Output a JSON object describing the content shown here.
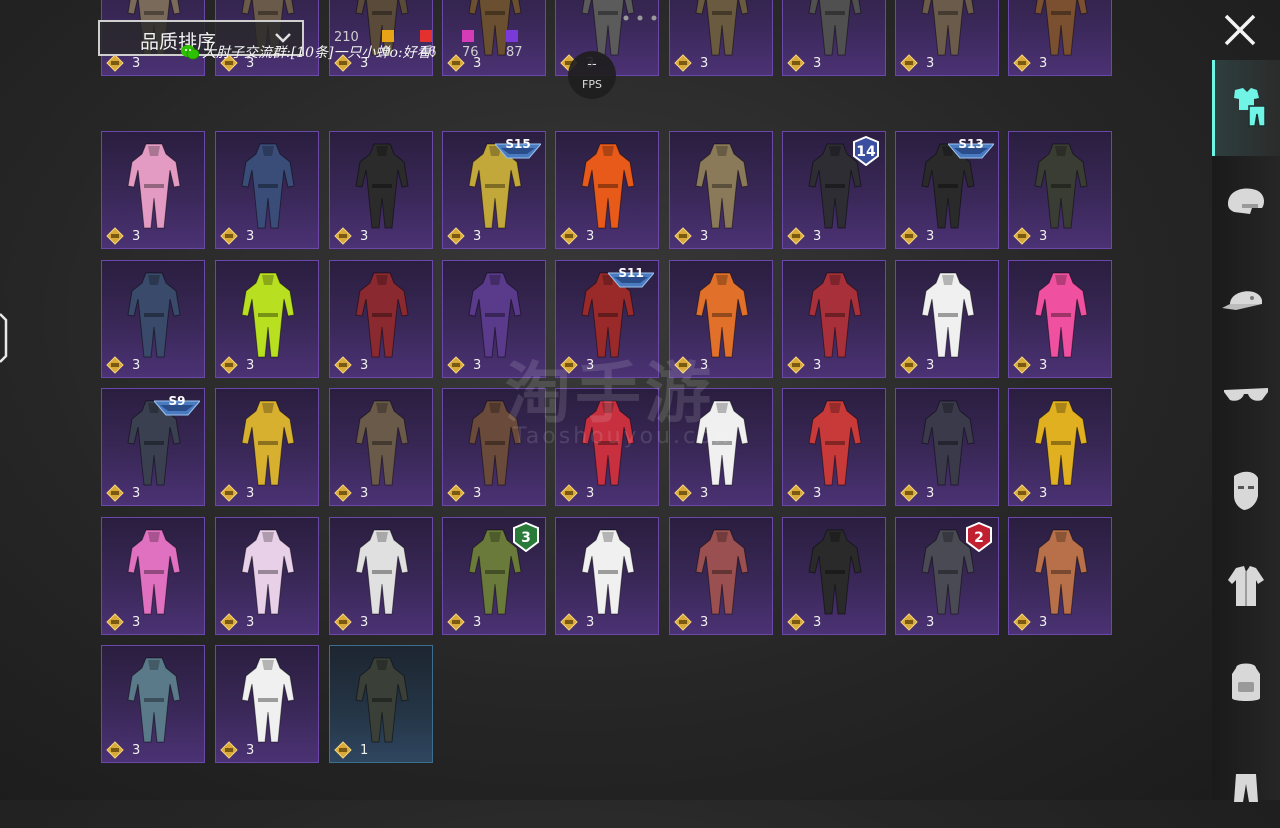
{
  "sort_dropdown": {
    "label": "品质排序"
  },
  "quality_counts": [
    {
      "value": "210",
      "color": ""
    },
    {
      "value": "0",
      "color": "#e8a317"
    },
    {
      "value": "46",
      "color": "#e53030"
    },
    {
      "value": "76",
      "color": "#d63bb8"
    },
    {
      "value": "87",
      "color": "#7a3ad9"
    }
  ],
  "notice": "大肘子交流群:[10条]一只小蝉o:好看!",
  "fps": {
    "value": "--",
    "unit": "FPS"
  },
  "watermark": {
    "line1": "淘手游",
    "line2": "Taoshouyou.com"
  },
  "sidebar_categories": [
    {
      "name": "outfit-icon",
      "active": true
    },
    {
      "name": "helmet-icon",
      "active": false
    },
    {
      "name": "cap-icon",
      "active": false
    },
    {
      "name": "glasses-icon",
      "active": false
    },
    {
      "name": "mask-icon",
      "active": false
    },
    {
      "name": "jacket-icon",
      "active": false
    },
    {
      "name": "backpack-icon",
      "active": false
    },
    {
      "name": "pants-icon",
      "active": false
    }
  ],
  "items": [
    {
      "row": 0,
      "col": 0,
      "count": "3",
      "color": "#7a6a5a"
    },
    {
      "row": 0,
      "col": 1,
      "count": "3",
      "color": "#6a5a4a"
    },
    {
      "row": 0,
      "col": 2,
      "count": "3",
      "color": "#5a4a3a"
    },
    {
      "row": 0,
      "col": 3,
      "count": "3",
      "color": "#6a5030"
    },
    {
      "row": 0,
      "col": 4,
      "count": "3",
      "color": "#5b5b5b"
    },
    {
      "row": 0,
      "col": 5,
      "count": "3",
      "color": "#6a5a40"
    },
    {
      "row": 0,
      "col": 6,
      "count": "3",
      "color": "#505050"
    },
    {
      "row": 0,
      "col": 7,
      "count": "3",
      "color": "#6b5b4b"
    },
    {
      "row": 0,
      "col": 8,
      "count": "3",
      "color": "#7a5030"
    },
    {
      "row": 1,
      "col": 0,
      "count": "3",
      "color": "#e39bc4"
    },
    {
      "row": 1,
      "col": 1,
      "count": "3",
      "color": "#3a4d78"
    },
    {
      "row": 1,
      "col": 2,
      "count": "3",
      "color": "#2b2b2b"
    },
    {
      "row": 1,
      "col": 3,
      "count": "3",
      "color": "#c2a73a",
      "season": "S15"
    },
    {
      "row": 1,
      "col": 4,
      "count": "3",
      "color": "#e85a1a"
    },
    {
      "row": 1,
      "col": 5,
      "count": "3",
      "color": "#8a7a5a"
    },
    {
      "row": 1,
      "col": 6,
      "count": "3",
      "color": "#2d2d33",
      "round": "14",
      "round_color": "#3a4fa0"
    },
    {
      "row": 1,
      "col": 7,
      "count": "3",
      "color": "#2a2a2a",
      "season": "S13"
    },
    {
      "row": 1,
      "col": 8,
      "count": "3",
      "color": "#3a3d33"
    },
    {
      "row": 2,
      "col": 0,
      "count": "3",
      "color": "#3a4a6a"
    },
    {
      "row": 2,
      "col": 1,
      "count": "3",
      "color": "#b8e020"
    },
    {
      "row": 2,
      "col": 2,
      "count": "3",
      "color": "#8a2a30"
    },
    {
      "row": 2,
      "col": 3,
      "count": "3",
      "color": "#5a3a8a"
    },
    {
      "row": 2,
      "col": 4,
      "count": "3",
      "color": "#9a2a2a",
      "season": "S11"
    },
    {
      "row": 2,
      "col": 5,
      "count": "3",
      "color": "#e0702a"
    },
    {
      "row": 2,
      "col": 6,
      "count": "3",
      "color": "#a8303a"
    },
    {
      "row": 2,
      "col": 7,
      "count": "3",
      "color": "#f0f0f0"
    },
    {
      "row": 2,
      "col": 8,
      "count": "3",
      "color": "#f050a0"
    },
    {
      "row": 3,
      "col": 0,
      "count": "3",
      "color": "#3a4050",
      "season": "S9"
    },
    {
      "row": 3,
      "col": 1,
      "count": "3",
      "color": "#d8b030"
    },
    {
      "row": 3,
      "col": 2,
      "count": "3",
      "color": "#6a5a4a"
    },
    {
      "row": 3,
      "col": 3,
      "count": "3",
      "color": "#6a4a3a"
    },
    {
      "row": 3,
      "col": 4,
      "count": "3",
      "color": "#c83040"
    },
    {
      "row": 3,
      "col": 5,
      "count": "3",
      "color": "#f0f0f0"
    },
    {
      "row": 3,
      "col": 6,
      "count": "3",
      "color": "#c83a3a"
    },
    {
      "row": 3,
      "col": 7,
      "count": "3",
      "color": "#3a3a4a"
    },
    {
      "row": 3,
      "col": 8,
      "count": "3",
      "color": "#e0b020"
    },
    {
      "row": 4,
      "col": 0,
      "count": "3",
      "color": "#e070c0"
    },
    {
      "row": 4,
      "col": 1,
      "count": "3",
      "color": "#e8d0e8"
    },
    {
      "row": 4,
      "col": 2,
      "count": "3",
      "color": "#e0e0e0"
    },
    {
      "row": 4,
      "col": 3,
      "count": "3",
      "color": "#6a7a3a",
      "round": "3",
      "round_color": "#2a7a3a"
    },
    {
      "row": 4,
      "col": 4,
      "count": "3",
      "color": "#f0f0f0"
    },
    {
      "row": 4,
      "col": 5,
      "count": "3",
      "color": "#9a5050"
    },
    {
      "row": 4,
      "col": 6,
      "count": "3",
      "color": "#2a2a2a"
    },
    {
      "row": 4,
      "col": 7,
      "count": "3",
      "color": "#4a4a55",
      "round": "2",
      "round_color": "#c02030"
    },
    {
      "row": 4,
      "col": 8,
      "count": "3",
      "color": "#b8704a"
    },
    {
      "row": 5,
      "col": 0,
      "count": "3",
      "color": "#5a7a8a"
    },
    {
      "row": 5,
      "col": 1,
      "count": "3",
      "color": "#f0f0f0"
    },
    {
      "row": 5,
      "col": 2,
      "count": "1",
      "color": "#3a3f38",
      "blue": true
    }
  ]
}
